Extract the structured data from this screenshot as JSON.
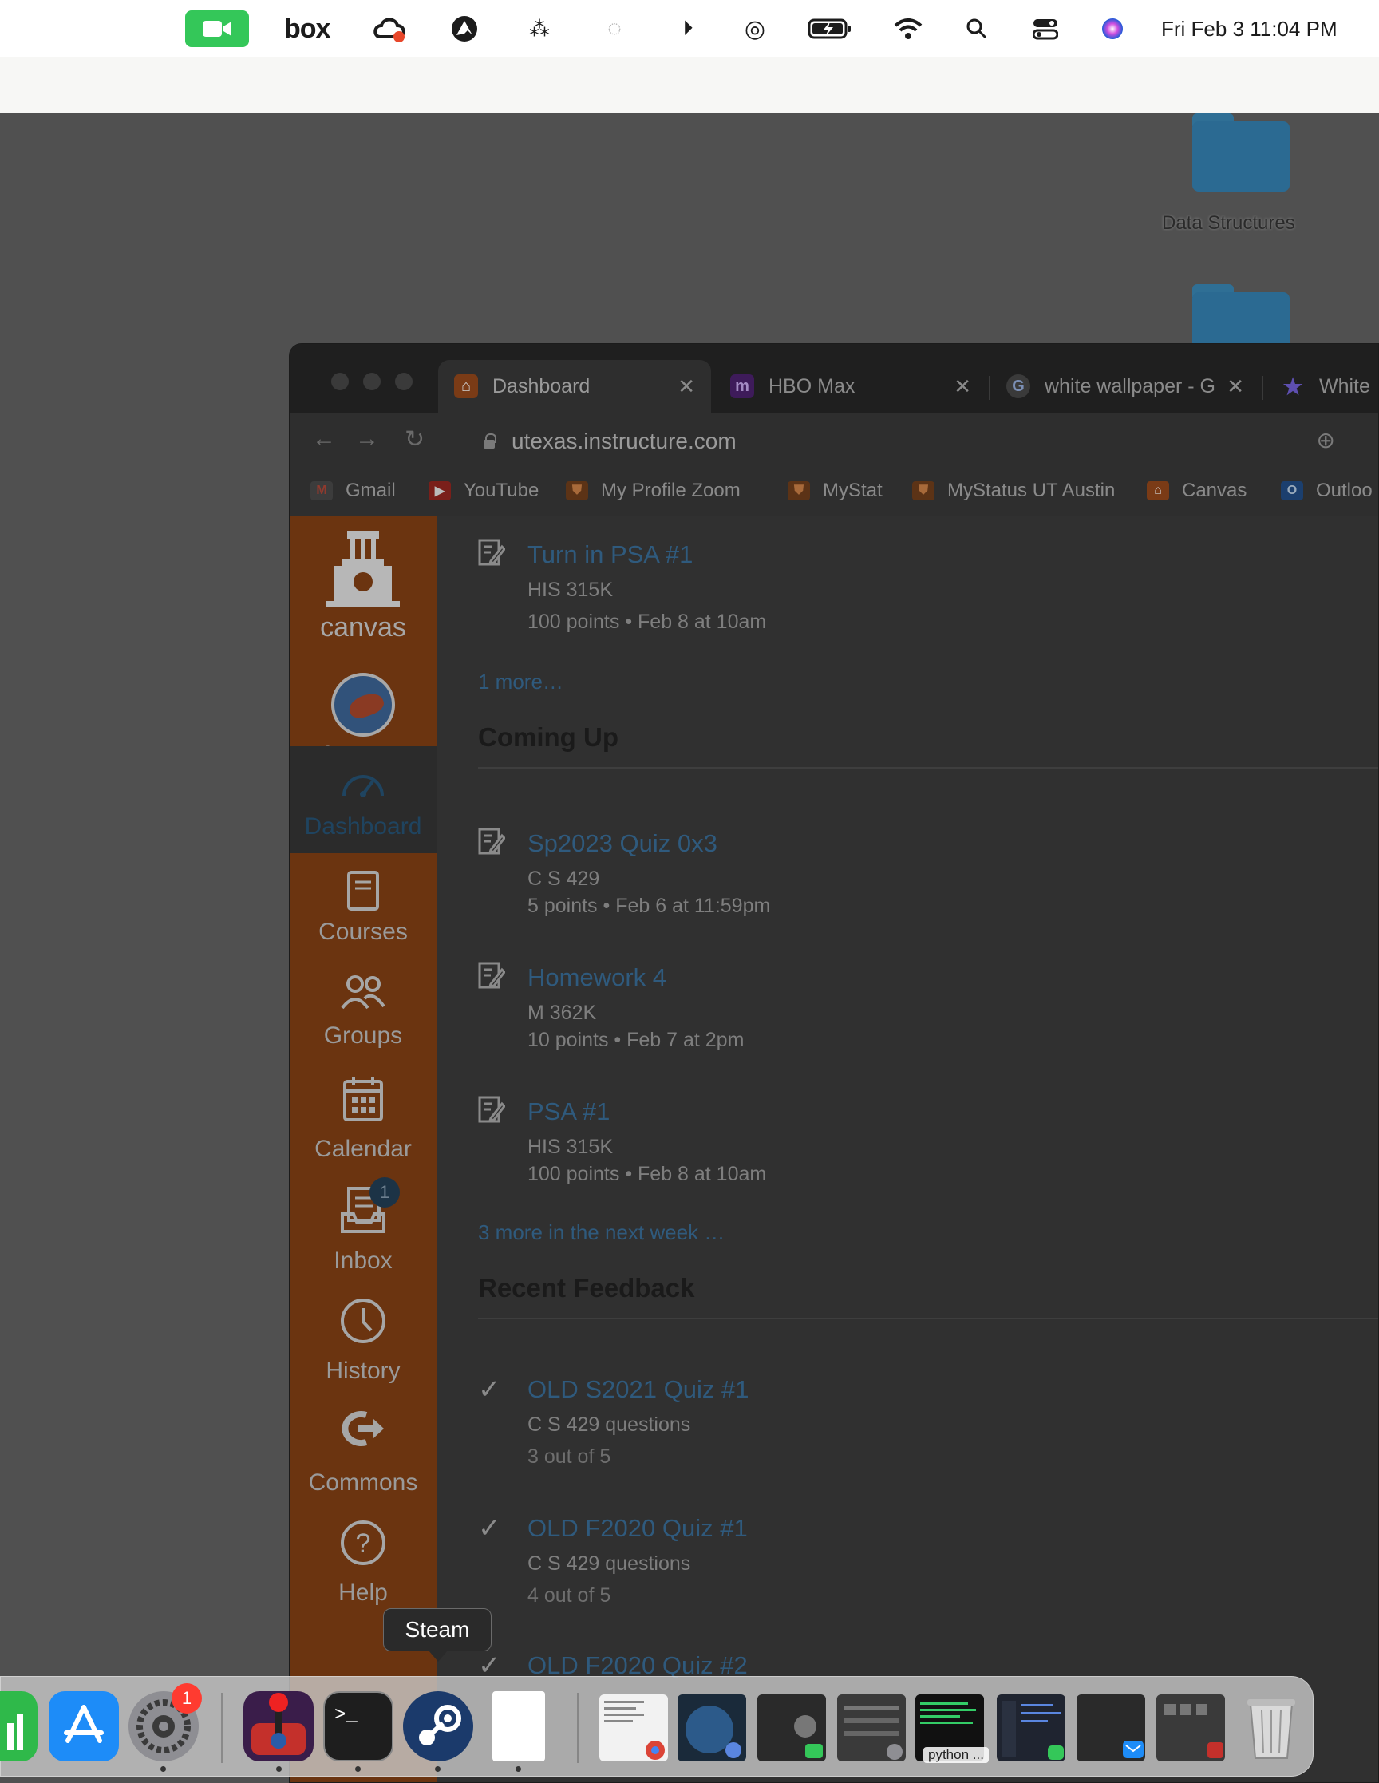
{
  "menubar": {
    "box_label": "box",
    "clock": "Fri Feb 3  11:04 PM",
    "icons": [
      "facetime-icon",
      "box-icon",
      "creative-cloud-icon",
      "nordvpn-icon",
      "airpods-icon",
      "loading-icon",
      "play-icon",
      "airdrop-icon",
      "battery-icon",
      "wifi-icon",
      "spotlight-icon",
      "control-center-icon",
      "siri-icon"
    ]
  },
  "desktop": {
    "folders": [
      {
        "label": "Data Structures"
      },
      {
        "label": ""
      }
    ]
  },
  "browser": {
    "tabs": [
      {
        "label": "Dashboard",
        "favicon": "canvas-favicon",
        "active": true
      },
      {
        "label": "HBO Max",
        "favicon": "hbo-favicon",
        "favicon_text": "m"
      },
      {
        "label": "white wallpaper - G",
        "favicon": "google-favicon",
        "favicon_text": "G"
      },
      {
        "label": "White",
        "favicon": "star-favicon"
      }
    ],
    "url": "utexas.instructure.com",
    "bookmarks": [
      {
        "label": "Gmail",
        "icon_text": "M"
      },
      {
        "label": "YouTube",
        "icon_text": "▶"
      },
      {
        "label": "My Profile Zoom",
        "icon_text": "⛊"
      },
      {
        "label": "MyStat",
        "icon_text": "⛊"
      },
      {
        "label": "MyStatus UT Austin",
        "icon_text": "⛊"
      },
      {
        "label": "Canvas",
        "icon_text": "⌂"
      },
      {
        "label": "Outloo",
        "icon_text": "O"
      }
    ]
  },
  "sidebar": {
    "logo_text": "canvas",
    "items": [
      {
        "label": "Account"
      },
      {
        "label": "Dashboard",
        "active": true
      },
      {
        "label": "Courses"
      },
      {
        "label": "Groups"
      },
      {
        "label": "Calendar"
      },
      {
        "label": "Inbox",
        "badge": "1"
      },
      {
        "label": "History"
      },
      {
        "label": "Commons"
      },
      {
        "label": "Help"
      }
    ]
  },
  "main": {
    "todo_top": {
      "title": "Turn in PSA #1",
      "course": "HIS 315K",
      "meta": "100 points • Feb 8 at 10am"
    },
    "todo_more": "1 more…",
    "coming_up": {
      "heading": "Coming Up",
      "items": [
        {
          "title": "Sp2023 Quiz 0x3",
          "course": "C S 429",
          "meta": "5 points • Feb 6 at 11:59pm"
        },
        {
          "title": "Homework 4",
          "course": "M 362K",
          "meta": "10 points • Feb 7 at 2pm"
        },
        {
          "title": "PSA #1",
          "course": "HIS 315K",
          "meta": "100 points • Feb 8 at 10am"
        }
      ],
      "more": "3 more in the next week …"
    },
    "recent_feedback": {
      "heading": "Recent Feedback",
      "items": [
        {
          "title": "OLD S2021 Quiz #1",
          "course": "C S 429 questions",
          "meta": "3 out of 5"
        },
        {
          "title": "OLD F2020 Quiz #1",
          "course": "C S 429 questions",
          "meta": "4 out of 5"
        },
        {
          "title": "OLD F2020 Quiz #2",
          "course": "",
          "meta": ""
        }
      ]
    }
  },
  "dock": {
    "tooltip": "Steam",
    "settings_badge": "1",
    "python_label": "python ...",
    "colors": {
      "steam": "#1b3a6b",
      "terminal": "#1e1e1e",
      "appstore": "#1d8cf8",
      "numbers": "#2fb94a"
    }
  }
}
